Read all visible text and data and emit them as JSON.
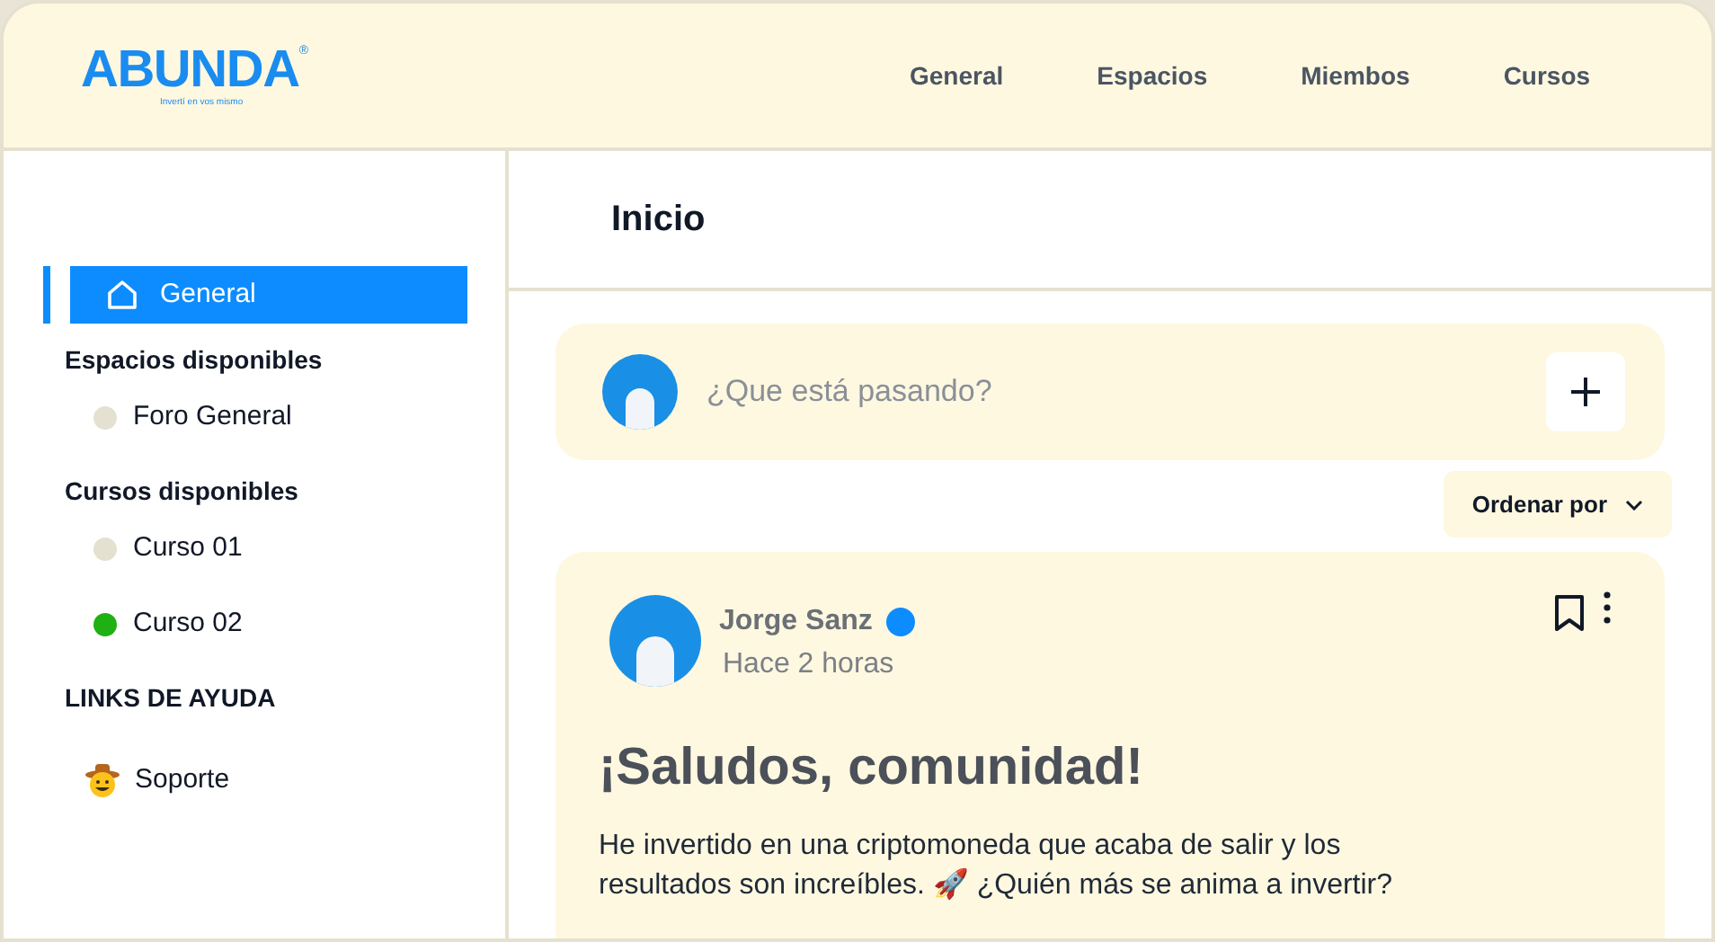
{
  "logo": {
    "name": "ABUNDA",
    "mark": "®",
    "tagline": "Invertí en vos mismo"
  },
  "nav": [
    "General",
    "Espacios",
    "Miembos",
    "Cursos"
  ],
  "sidebar": {
    "items": [
      {
        "label": "General",
        "selected": true
      }
    ],
    "sections": [
      {
        "title": "Espacios disponibles",
        "items": [
          {
            "label": "Foro General",
            "color": "#e5e1d1"
          }
        ]
      },
      {
        "title": "Cursos disponibles",
        "items": [
          {
            "label": "Curso 01",
            "color": "#e5e1d1"
          },
          {
            "label": "Curso 02",
            "color": "#1fb014"
          }
        ]
      }
    ],
    "help": {
      "title": "LINKS DE AYUDA",
      "items": [
        {
          "label": "Soporte"
        }
      ]
    }
  },
  "page_title": "Inicio",
  "composer": {
    "placeholder": "¿Que está pasando?"
  },
  "sort_button": "Ordenar por",
  "post": {
    "author": "Jorge Sanz",
    "verified": true,
    "time": "Hace 2 horas",
    "title": "¡Saludos, comunidad!",
    "body": "He invertido en una criptomoneda que acaba de salir y los resultados son increíbles. 🚀 ¿Quién más se anima a invertir?"
  }
}
